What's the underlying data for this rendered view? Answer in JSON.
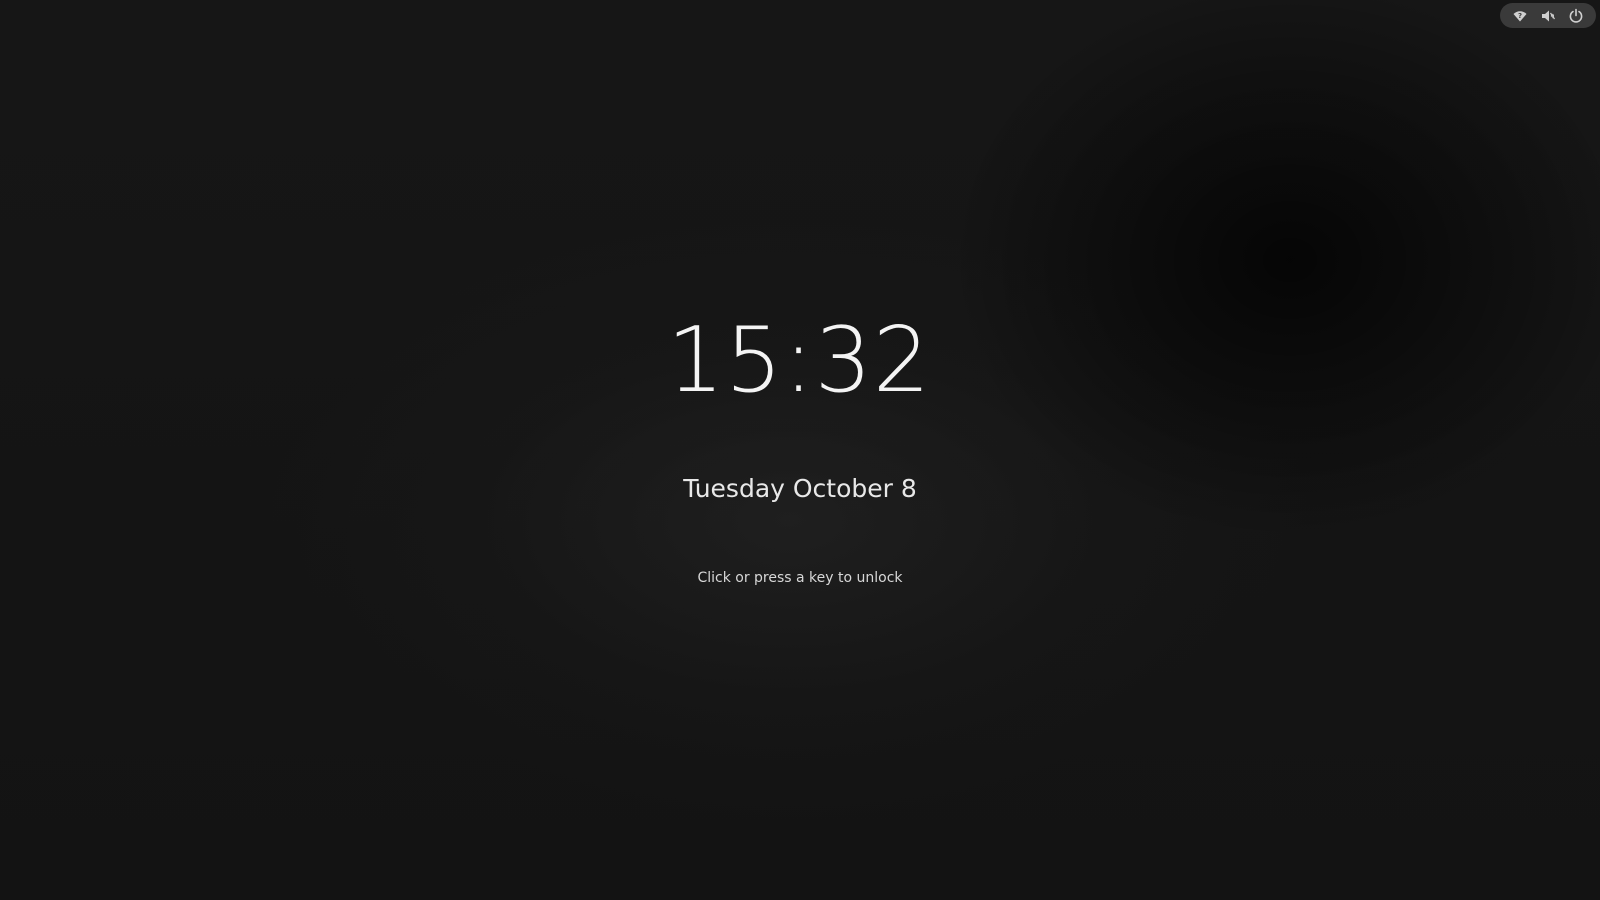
{
  "lock_screen": {
    "time": "15:32",
    "date": "Tuesday October 8",
    "unlock_hint": "Click or press a key to unlock"
  },
  "top_bar": {
    "icons": [
      "network-wireless-icon",
      "volume-muted-icon",
      "power-icon"
    ]
  },
  "colors": {
    "background": "#151515",
    "pill_background": "#3a3a3a",
    "text": "#ffffff",
    "icon": "#d0d0d0"
  }
}
